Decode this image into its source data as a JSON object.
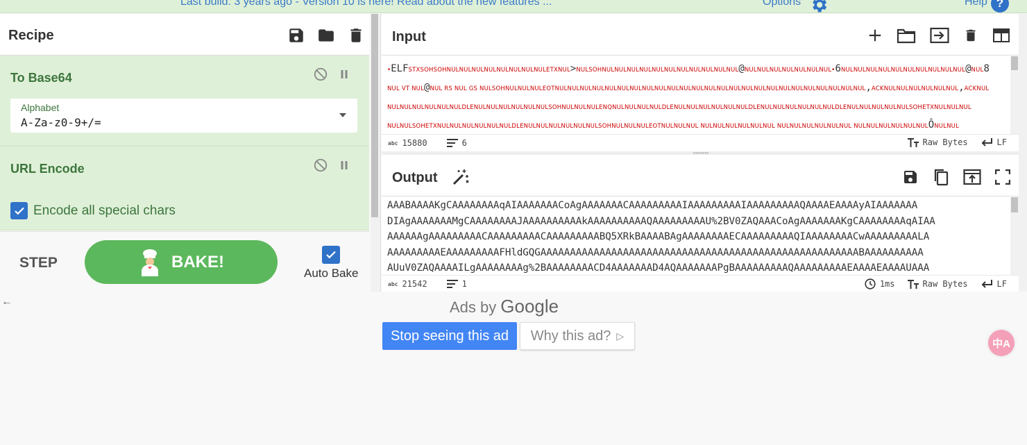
{
  "banner": {
    "message": "Last build: 3 years ago - Version 10 is here! Read about the new features ...",
    "options_label": "Options",
    "help_label": "Help",
    "help_icon_glyph": "?"
  },
  "recipe": {
    "title": "Recipe",
    "operations": [
      {
        "title": "To Base64",
        "field_label": "Alphabet",
        "field_value": "A-Za-z0-9+/="
      },
      {
        "title": "URL Encode",
        "checkbox_label": "Encode all special chars",
        "checkbox_checked": true
      }
    ]
  },
  "controls": {
    "step_label": "STEP",
    "bake_label": "BAKE!",
    "auto_bake_label": "Auto Bake",
    "auto_bake_checked": true,
    "back_glyph": "←"
  },
  "input": {
    "title": "Input",
    "lines": [
      [
        {
          "t": "•",
          "c": true
        },
        {
          "t": "ELF"
        },
        {
          "t": "STXSOHSOHNULNULNULNULNULNULNULNULETXNUL",
          "c": true
        },
        {
          "t": ">"
        },
        {
          "t": "NULSOHNULNULNULNULNULNULNULNULNULNULNUL",
          "c": true
        },
        {
          "t": "@"
        },
        {
          "t": "NULNULNULNULNULNULNUL",
          "c": true
        },
        {
          "t": "•",
          "c": true
        },
        {
          "t": "6"
        },
        {
          "t": "NULNULNULNULNULNULNULNULNULNUL",
          "c": true
        },
        {
          "t": "@"
        },
        {
          "t": "NUL",
          "c": true
        },
        {
          "t": "8"
        }
      ],
      [
        {
          "t": "NUL VT NUL",
          "c": true
        },
        {
          "t": "@"
        },
        {
          "t": "NUL RS NUL GS NULSOHNULNULNULEOTNULNULNULNULNULNULNULNULNULNULNULNULNULNULNULNULNULNULNULNULNULNULNULNULNUL",
          "c": true
        },
        {
          "t": ","
        },
        {
          "t": "ACKNULNULNULNULNULNUL",
          "c": true
        },
        {
          "t": ","
        },
        {
          "t": "ACKNUL",
          "c": true
        }
      ],
      [
        {
          "t": "NULNULNULNULNULNULDLENULNULNULNULNULNULSOHNULNULNULENQNULNULNULNULDLENULNULNULNULNULNULDLENULNULNULNULNULNULDLENULNULNULNULNULSOHETXNULNULNUL",
          "c": true
        }
      ],
      [
        {
          "t": "NULNULSOHETXNULNULNULNULNULNULDLENULNULNULNULNULNULSOHNULNULNULEOTNULNULNUL  NULNULNULNULNULNUL  NULNULNULNULNULNUL  NULNULNULNULNULNUL",
          "c": true
        },
        {
          "t": "Ô"
        },
        {
          "t": "NULNUL",
          "c": true
        }
      ]
    ],
    "status": {
      "length": "15880",
      "lines": "6",
      "encoding": "Raw Bytes",
      "eol": "LF",
      "abc_label": "abc"
    }
  },
  "output": {
    "title": "Output",
    "lines": [
      "AAABAAAAKgCAAAAAAAAqAIAAAAAAACoAgAAAAAAACAAAAAAAAAIAAAAAAAAAIAAAAAAAAAQAAAAEAAAAyAIAAAAAAA",
      "DIAgAAAAAAAMgCAAAAAAAAJAAAAAAAAAAkAAAAAAAAAAQAAAAAAAAAU%2BV0ZAQAAACoAgAAAAAAAKgCAAAAAAAAqAIAA",
      "AAAAAAgAAAAAAAAACAAAAAAAAACAAAAAAAAABQ5XRkBAAAABAgAAAAAAAAECAAAAAAAAAQIAAAAAAAACwAAAAAAAAALA",
      "AAAAAAAAAEAAAAAAAAAFHldGQGAAAAAAAAAAAAAAAAAAAAAAAAAAAAAAAAAAAAAAAAAAAAAAAAAAAAAABAAAAAAAAAA",
      "AUuV0ZAQAAAAILgAAAAAAAAg%2BAAAAAAAACD4AAAAAAAD4AQAAAAAAAPgBAAAAAAAAAQAAAAAAAAAEAAAAEAAAAUAAA"
    ],
    "status": {
      "length": "21542",
      "lines": "1",
      "time": "1ms",
      "encoding": "Raw Bytes",
      "eol": "LF",
      "abc_label": "abc"
    }
  },
  "ads": {
    "ads_by": "Ads by",
    "google": "Google",
    "stop_label": "Stop seeing this ad",
    "why_label": "Why this ad?",
    "why_glyph": "▷"
  },
  "translate_label": "中A",
  "colors": {
    "accent": "#2f72c8",
    "operation_bg": "#dff0d8",
    "operation_text": "#3c763d",
    "bake_green": "#5cb85c",
    "control_char": "#cc0000",
    "ad_blue": "#4285f4"
  }
}
